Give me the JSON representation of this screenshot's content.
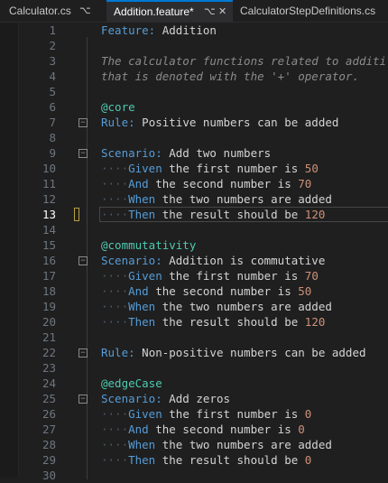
{
  "tabs": [
    {
      "label": "Calculator.cs",
      "pin": "⌥",
      "active": false
    },
    {
      "label": "Addition.feature*",
      "pin": "⌥",
      "close": "✕",
      "active": true
    },
    {
      "label": "CalculatorStepDefinitions.cs",
      "active": false
    }
  ],
  "current_line": 13,
  "lines": [
    {
      "n": "1",
      "tokens": [
        {
          "t": "Feature:",
          "c": "kw"
        },
        {
          "t": " Addition",
          "c": "text"
        }
      ]
    },
    {
      "n": "2",
      "tokens": []
    },
    {
      "n": "3",
      "tokens": [
        {
          "t": "The calculator functions related to additi",
          "c": "desc"
        }
      ]
    },
    {
      "n": "4",
      "tokens": [
        {
          "t": "that is denoted with the '+' operator.",
          "c": "desc"
        }
      ]
    },
    {
      "n": "5",
      "tokens": []
    },
    {
      "n": "6",
      "tokens": [
        {
          "t": "@core",
          "c": "tag"
        }
      ]
    },
    {
      "n": "7",
      "fold": true,
      "tokens": [
        {
          "t": "Rule:",
          "c": "kw"
        },
        {
          "t": " Positive numbers can be added",
          "c": "text"
        }
      ]
    },
    {
      "n": "8",
      "tokens": []
    },
    {
      "n": "9",
      "fold": true,
      "tokens": [
        {
          "t": "Scenario:",
          "c": "kw"
        },
        {
          "t": " Add two numbers",
          "c": "text"
        }
      ]
    },
    {
      "n": "10",
      "tokens": [
        {
          "t": "····",
          "c": "dots"
        },
        {
          "t": "Given",
          "c": "step"
        },
        {
          "t": " the first number is ",
          "c": "text"
        },
        {
          "t": "50",
          "c": "num"
        }
      ]
    },
    {
      "n": "11",
      "tokens": [
        {
          "t": "····",
          "c": "dots"
        },
        {
          "t": "And",
          "c": "step"
        },
        {
          "t": " the second number is ",
          "c": "text"
        },
        {
          "t": "70",
          "c": "num"
        }
      ]
    },
    {
      "n": "12",
      "tokens": [
        {
          "t": "····",
          "c": "dots"
        },
        {
          "t": "When",
          "c": "step"
        },
        {
          "t": " the two numbers are added",
          "c": "text"
        }
      ]
    },
    {
      "n": "13",
      "marker": true,
      "tokens": [
        {
          "t": "····",
          "c": "dots"
        },
        {
          "t": "Then",
          "c": "step"
        },
        {
          "t": " the result should be ",
          "c": "text"
        },
        {
          "t": "120",
          "c": "num"
        }
      ]
    },
    {
      "n": "14",
      "tokens": []
    },
    {
      "n": "15",
      "tokens": [
        {
          "t": "@commutativity",
          "c": "tag"
        }
      ]
    },
    {
      "n": "16",
      "fold": true,
      "tokens": [
        {
          "t": "Scenario:",
          "c": "kw"
        },
        {
          "t": " Addition is commutative",
          "c": "text"
        }
      ]
    },
    {
      "n": "17",
      "tokens": [
        {
          "t": "····",
          "c": "dots"
        },
        {
          "t": "Given",
          "c": "step"
        },
        {
          "t": " the first number is ",
          "c": "text"
        },
        {
          "t": "70",
          "c": "num"
        }
      ]
    },
    {
      "n": "18",
      "tokens": [
        {
          "t": "····",
          "c": "dots"
        },
        {
          "t": "And",
          "c": "step"
        },
        {
          "t": " the second number is ",
          "c": "text"
        },
        {
          "t": "50",
          "c": "num"
        }
      ]
    },
    {
      "n": "19",
      "tokens": [
        {
          "t": "····",
          "c": "dots"
        },
        {
          "t": "When",
          "c": "step"
        },
        {
          "t": " the two numbers are added",
          "c": "text"
        }
      ]
    },
    {
      "n": "20",
      "tokens": [
        {
          "t": "····",
          "c": "dots"
        },
        {
          "t": "Then",
          "c": "step"
        },
        {
          "t": " the result should be ",
          "c": "text"
        },
        {
          "t": "120",
          "c": "num"
        }
      ]
    },
    {
      "n": "21",
      "tokens": []
    },
    {
      "n": "22",
      "fold": true,
      "tokens": [
        {
          "t": "Rule:",
          "c": "kw"
        },
        {
          "t": " Non-positive numbers can be added",
          "c": "text"
        }
      ]
    },
    {
      "n": "23",
      "tokens": []
    },
    {
      "n": "24",
      "tokens": [
        {
          "t": "@edgeCase",
          "c": "tag"
        }
      ]
    },
    {
      "n": "25",
      "fold": true,
      "tokens": [
        {
          "t": "Scenario:",
          "c": "kw"
        },
        {
          "t": " Add zeros",
          "c": "text"
        }
      ]
    },
    {
      "n": "26",
      "tokens": [
        {
          "t": "····",
          "c": "dots"
        },
        {
          "t": "Given",
          "c": "step"
        },
        {
          "t": " the first number is ",
          "c": "text"
        },
        {
          "t": "0",
          "c": "num"
        }
      ]
    },
    {
      "n": "27",
      "tokens": [
        {
          "t": "····",
          "c": "dots"
        },
        {
          "t": "And",
          "c": "step"
        },
        {
          "t": " the second number is ",
          "c": "text"
        },
        {
          "t": "0",
          "c": "num"
        }
      ]
    },
    {
      "n": "28",
      "tokens": [
        {
          "t": "····",
          "c": "dots"
        },
        {
          "t": "When",
          "c": "step"
        },
        {
          "t": " the two numbers are added",
          "c": "text"
        }
      ]
    },
    {
      "n": "29",
      "tokens": [
        {
          "t": "····",
          "c": "dots"
        },
        {
          "t": "Then",
          "c": "step"
        },
        {
          "t": " the result should be ",
          "c": "text"
        },
        {
          "t": "0",
          "c": "num"
        }
      ]
    },
    {
      "n": "30",
      "tokens": []
    }
  ]
}
